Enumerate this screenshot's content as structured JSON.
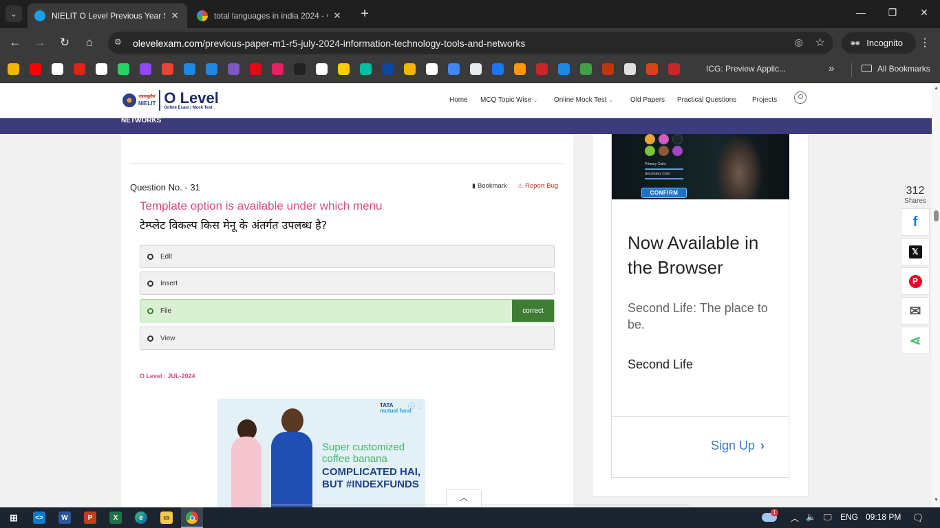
{
  "browser": {
    "tabs": [
      {
        "title": "NIELIT O Level Previous Year So",
        "active": true,
        "favicon_color": "#1aa0e8"
      },
      {
        "title": "total languages in india 2024 - G",
        "active": false,
        "favicon_color": "#ffffff"
      }
    ],
    "new_tab_symbol": "+",
    "close_symbol": "✕",
    "window_controls": [
      "—",
      "❐",
      "✕"
    ],
    "url_host": "olevelexam.com",
    "url_path": "/previous-paper-m1-r5-july-2024-information-technology-tools-and-networks",
    "incognito_label": "Incognito",
    "bookmark_last_label": "ICG: Preview Applic...",
    "all_bookmarks_label": "All Bookmarks",
    "bookmark_colors": [
      "#f4b400",
      "#ff0000",
      "#ffffff",
      "#e62117",
      "#ffffff",
      "#25d366",
      "#9146ff",
      "#ea4335",
      "#1e88e5",
      "#1e88e5",
      "#7e57c2",
      "#e50914",
      "#e91e63",
      "#222222",
      "#ffffff",
      "#ffcc00",
      "#00bfa5",
      "#0d47a1",
      "#f4b400",
      "#ffffff",
      "#4285f4",
      "#e8eaed",
      "#1877f2",
      "#ff9800",
      "#c62828",
      "#1e88e5",
      "#43a047",
      "#bf360c",
      "#e0e0e0",
      "#d84315",
      "#c62828"
    ]
  },
  "site": {
    "logo_hindi": "राइलसूप्रौसं",
    "logo_nielit": "NIELIT",
    "logo_title": "O Level",
    "logo_subtitle": "Online Exam | Mock Test",
    "nav": [
      "Home",
      "MCQ Topic Wise",
      "Online Mock Test",
      "Old Papers",
      "Practical Questions",
      "Projects"
    ],
    "band_text": "NETWORKS"
  },
  "question": {
    "number_label": "Question No. - 31",
    "bookmark_label": "Bookmark",
    "report_label": "Report Bug",
    "text_en": "Template option is available under which menu",
    "text_hi": "टेम्प्लेट विकल्प किस मेनू के अंतर्गत उपलब्ध है?",
    "options": [
      {
        "label": "Edit",
        "correct": false
      },
      {
        "label": "Insert",
        "correct": false
      },
      {
        "label": "File",
        "correct": true
      },
      {
        "label": "View",
        "correct": false
      }
    ],
    "correct_tag": "correct",
    "source": "O Level : JUL-2024"
  },
  "ad_inline": {
    "brand_line1": "TATA",
    "brand_line2": "mutual fund",
    "headline1": "Super customized coffee banana",
    "headline2": "COMPLICATED HAI, BUT #INDEXFUNDS"
  },
  "ad_sidebar": {
    "confirm_label": "CONFIRM",
    "primary_color_label": "Primary Color",
    "secondary_color_label": "Secondary Color",
    "swatch_colors": [
      "#e6a33c",
      "#d05cc4",
      "#1a2b2f",
      "#7cc23a",
      "#8a5a3a",
      "#a044c8"
    ],
    "title": "Now Available in the Browser",
    "description": "Second Life: The place to be.",
    "brand": "Second Life",
    "cta": "Sign Up"
  },
  "share": {
    "count": "312",
    "label": "Shares",
    "buttons": [
      {
        "icon": "facebook-icon",
        "glyph": "f",
        "color": "#1877f2"
      },
      {
        "icon": "x-icon",
        "glyph": "𝕏",
        "color": "#111111"
      },
      {
        "icon": "pinterest-icon",
        "glyph": "P",
        "color": "#e60023"
      },
      {
        "icon": "email-icon",
        "glyph": "✉",
        "color": "#555555"
      },
      {
        "icon": "share-icon",
        "glyph": "⋖",
        "color": "#3fbf5f"
      }
    ]
  },
  "taskbar": {
    "language": "ENG",
    "time": "09:18 PM",
    "notification_count": "1"
  }
}
